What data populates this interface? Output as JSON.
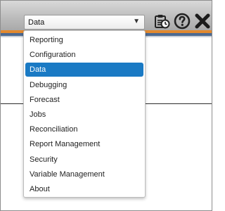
{
  "toolbar": {
    "selected_value": "Data",
    "icons": [
      "clipboard-clock-icon",
      "help-icon",
      "close-icon"
    ]
  },
  "menu": {
    "items": [
      {
        "label": "Reporting",
        "selected": false
      },
      {
        "label": "Configuration",
        "selected": false
      },
      {
        "label": "Data",
        "selected": true
      },
      {
        "label": "Debugging",
        "selected": false
      },
      {
        "label": "Forecast",
        "selected": false
      },
      {
        "label": "Jobs",
        "selected": false
      },
      {
        "label": "Reconciliation",
        "selected": false
      },
      {
        "label": "Report Management",
        "selected": false
      },
      {
        "label": "Security",
        "selected": false
      },
      {
        "label": "Variable Management",
        "selected": false
      },
      {
        "label": "About",
        "selected": false
      }
    ]
  },
  "colors": {
    "selected_bg": "#1a7ac4",
    "stripe_orange": "#e2892f",
    "stripe_blue": "#4c6a92"
  }
}
